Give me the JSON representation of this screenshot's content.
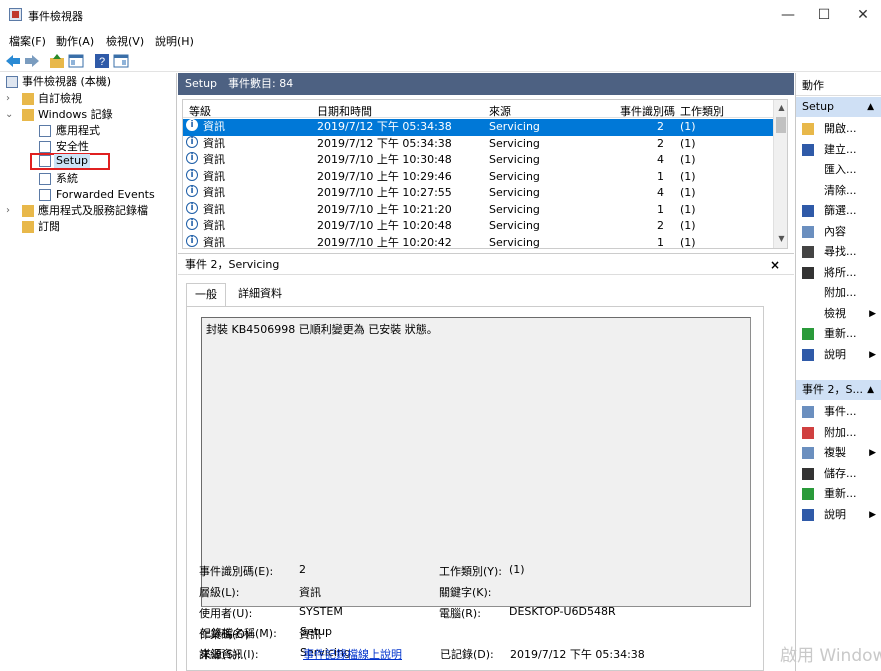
{
  "window": {
    "title": "事件檢視器",
    "minimize": "—",
    "maximize": "☐",
    "close": "✕"
  },
  "menu": [
    "檔案(F)",
    "動作(A)",
    "檢視(V)",
    "說明(H)"
  ],
  "tree": {
    "root": "事件檢視器 (本機)",
    "custom_views": "自訂檢視",
    "windows_logs": "Windows 記錄",
    "application": "應用程式",
    "security": "安全性",
    "setup": "Setup",
    "system": "系統",
    "forwarded": "Forwarded Events",
    "app_services": "應用程式及服務記錄檔",
    "subscriptions": "訂閱"
  },
  "log": {
    "name": "Setup",
    "count_label": "事件數目: 84"
  },
  "grid": {
    "headers": [
      "等級",
      "日期和時間",
      "來源",
      "事件識別碼",
      "工作類別"
    ],
    "rows": [
      {
        "level": "資訊",
        "datetime": "2019/7/12 下午 05:34:38",
        "source": "Servicing",
        "id": "2",
        "category": "(1)"
      },
      {
        "level": "資訊",
        "datetime": "2019/7/12 下午 05:34:38",
        "source": "Servicing",
        "id": "2",
        "category": "(1)"
      },
      {
        "level": "資訊",
        "datetime": "2019/7/10 上午 10:30:48",
        "source": "Servicing",
        "id": "4",
        "category": "(1)"
      },
      {
        "level": "資訊",
        "datetime": "2019/7/10 上午 10:29:46",
        "source": "Servicing",
        "id": "1",
        "category": "(1)"
      },
      {
        "level": "資訊",
        "datetime": "2019/7/10 上午 10:27:55",
        "source": "Servicing",
        "id": "4",
        "category": "(1)"
      },
      {
        "level": "資訊",
        "datetime": "2019/7/10 上午 10:21:20",
        "source": "Servicing",
        "id": "1",
        "category": "(1)"
      },
      {
        "level": "資訊",
        "datetime": "2019/7/10 上午 10:20:48",
        "source": "Servicing",
        "id": "2",
        "category": "(1)"
      },
      {
        "level": "資訊",
        "datetime": "2019/7/10 上午 10:20:42",
        "source": "Servicing",
        "id": "1",
        "category": "(1)"
      }
    ]
  },
  "detail": {
    "title": "事件 2，Servicing",
    "close": "×",
    "tab_general": "一般",
    "tab_details": "詳細資料",
    "message": "封裝 KB4506998 已順利變更為 已安裝 狀態。",
    "fields": {
      "log_name_label": "記錄檔名稱(M):",
      "log_name": "Setup",
      "source_label": "來源(S):",
      "source": "Servicing",
      "logged_label": "已記錄(D):",
      "logged": "2019/7/12 下午 05:34:38",
      "event_id_label": "事件識別碼(E):",
      "event_id": "2",
      "task_label": "工作類別(Y):",
      "task": "(1)",
      "level_label": "層級(L):",
      "level": "資訊",
      "keywords_label": "關鍵字(K):",
      "user_label": "使用者(U):",
      "user": "SYSTEM",
      "computer_label": "電腦(R):",
      "computer": "DESKTOP-U6D548R",
      "opcode_label": "作業碼(O):",
      "opcode": "資訊",
      "more_label": "詳細資訊(I):",
      "more_link": "事件記錄檔線上說明"
    }
  },
  "actions": {
    "header": "動作",
    "section1": "Setup",
    "items1": [
      "開啟...",
      "建立...",
      "匯入...",
      "清除...",
      "篩選...",
      "內容",
      "尋找...",
      "將所...",
      "附加...",
      "檢視",
      "重新...",
      "說明"
    ],
    "section2": "事件 2，S...",
    "items2": [
      "事件...",
      "附加...",
      "複製",
      "儲存...",
      "重新...",
      "說明"
    ]
  },
  "watermark": "啟用 Windows"
}
